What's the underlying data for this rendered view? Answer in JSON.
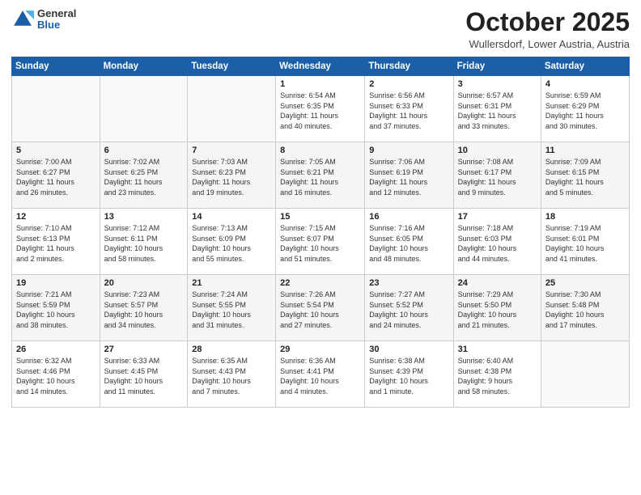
{
  "header": {
    "logo": {
      "general": "General",
      "blue": "Blue"
    },
    "title": "October 2025",
    "location": "Wullersdorf, Lower Austria, Austria"
  },
  "weekdays": [
    "Sunday",
    "Monday",
    "Tuesday",
    "Wednesday",
    "Thursday",
    "Friday",
    "Saturday"
  ],
  "weeks": [
    [
      {
        "day": "",
        "info": ""
      },
      {
        "day": "",
        "info": ""
      },
      {
        "day": "",
        "info": ""
      },
      {
        "day": "1",
        "info": "Sunrise: 6:54 AM\nSunset: 6:35 PM\nDaylight: 11 hours\nand 40 minutes."
      },
      {
        "day": "2",
        "info": "Sunrise: 6:56 AM\nSunset: 6:33 PM\nDaylight: 11 hours\nand 37 minutes."
      },
      {
        "day": "3",
        "info": "Sunrise: 6:57 AM\nSunset: 6:31 PM\nDaylight: 11 hours\nand 33 minutes."
      },
      {
        "day": "4",
        "info": "Sunrise: 6:59 AM\nSunset: 6:29 PM\nDaylight: 11 hours\nand 30 minutes."
      }
    ],
    [
      {
        "day": "5",
        "info": "Sunrise: 7:00 AM\nSunset: 6:27 PM\nDaylight: 11 hours\nand 26 minutes."
      },
      {
        "day": "6",
        "info": "Sunrise: 7:02 AM\nSunset: 6:25 PM\nDaylight: 11 hours\nand 23 minutes."
      },
      {
        "day": "7",
        "info": "Sunrise: 7:03 AM\nSunset: 6:23 PM\nDaylight: 11 hours\nand 19 minutes."
      },
      {
        "day": "8",
        "info": "Sunrise: 7:05 AM\nSunset: 6:21 PM\nDaylight: 11 hours\nand 16 minutes."
      },
      {
        "day": "9",
        "info": "Sunrise: 7:06 AM\nSunset: 6:19 PM\nDaylight: 11 hours\nand 12 minutes."
      },
      {
        "day": "10",
        "info": "Sunrise: 7:08 AM\nSunset: 6:17 PM\nDaylight: 11 hours\nand 9 minutes."
      },
      {
        "day": "11",
        "info": "Sunrise: 7:09 AM\nSunset: 6:15 PM\nDaylight: 11 hours\nand 5 minutes."
      }
    ],
    [
      {
        "day": "12",
        "info": "Sunrise: 7:10 AM\nSunset: 6:13 PM\nDaylight: 11 hours\nand 2 minutes."
      },
      {
        "day": "13",
        "info": "Sunrise: 7:12 AM\nSunset: 6:11 PM\nDaylight: 10 hours\nand 58 minutes."
      },
      {
        "day": "14",
        "info": "Sunrise: 7:13 AM\nSunset: 6:09 PM\nDaylight: 10 hours\nand 55 minutes."
      },
      {
        "day": "15",
        "info": "Sunrise: 7:15 AM\nSunset: 6:07 PM\nDaylight: 10 hours\nand 51 minutes."
      },
      {
        "day": "16",
        "info": "Sunrise: 7:16 AM\nSunset: 6:05 PM\nDaylight: 10 hours\nand 48 minutes."
      },
      {
        "day": "17",
        "info": "Sunrise: 7:18 AM\nSunset: 6:03 PM\nDaylight: 10 hours\nand 44 minutes."
      },
      {
        "day": "18",
        "info": "Sunrise: 7:19 AM\nSunset: 6:01 PM\nDaylight: 10 hours\nand 41 minutes."
      }
    ],
    [
      {
        "day": "19",
        "info": "Sunrise: 7:21 AM\nSunset: 5:59 PM\nDaylight: 10 hours\nand 38 minutes."
      },
      {
        "day": "20",
        "info": "Sunrise: 7:23 AM\nSunset: 5:57 PM\nDaylight: 10 hours\nand 34 minutes."
      },
      {
        "day": "21",
        "info": "Sunrise: 7:24 AM\nSunset: 5:55 PM\nDaylight: 10 hours\nand 31 minutes."
      },
      {
        "day": "22",
        "info": "Sunrise: 7:26 AM\nSunset: 5:54 PM\nDaylight: 10 hours\nand 27 minutes."
      },
      {
        "day": "23",
        "info": "Sunrise: 7:27 AM\nSunset: 5:52 PM\nDaylight: 10 hours\nand 24 minutes."
      },
      {
        "day": "24",
        "info": "Sunrise: 7:29 AM\nSunset: 5:50 PM\nDaylight: 10 hours\nand 21 minutes."
      },
      {
        "day": "25",
        "info": "Sunrise: 7:30 AM\nSunset: 5:48 PM\nDaylight: 10 hours\nand 17 minutes."
      }
    ],
    [
      {
        "day": "26",
        "info": "Sunrise: 6:32 AM\nSunset: 4:46 PM\nDaylight: 10 hours\nand 14 minutes."
      },
      {
        "day": "27",
        "info": "Sunrise: 6:33 AM\nSunset: 4:45 PM\nDaylight: 10 hours\nand 11 minutes."
      },
      {
        "day": "28",
        "info": "Sunrise: 6:35 AM\nSunset: 4:43 PM\nDaylight: 10 hours\nand 7 minutes."
      },
      {
        "day": "29",
        "info": "Sunrise: 6:36 AM\nSunset: 4:41 PM\nDaylight: 10 hours\nand 4 minutes."
      },
      {
        "day": "30",
        "info": "Sunrise: 6:38 AM\nSunset: 4:39 PM\nDaylight: 10 hours\nand 1 minute."
      },
      {
        "day": "31",
        "info": "Sunrise: 6:40 AM\nSunset: 4:38 PM\nDaylight: 9 hours\nand 58 minutes."
      },
      {
        "day": "",
        "info": ""
      }
    ]
  ]
}
